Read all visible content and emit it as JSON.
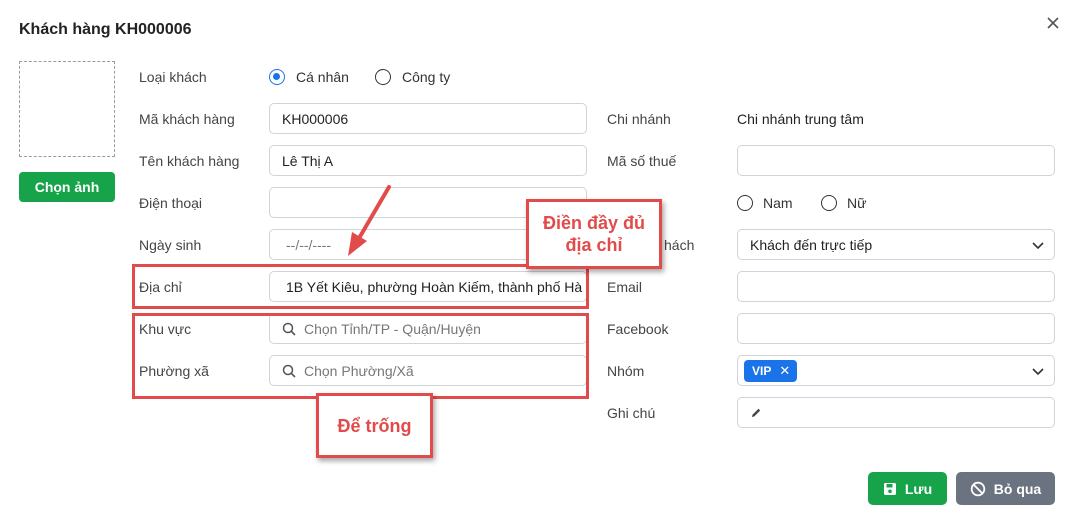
{
  "dialog": {
    "title": "Khách hàng KH000006"
  },
  "photo": {
    "button_label": "Chọn ảnh"
  },
  "left": {
    "customer_type_label": "Loại khách",
    "type_personal": "Cá nhân",
    "type_company": "Công ty",
    "customer_code_label": "Mã khách hàng",
    "customer_code_value": "KH000006",
    "customer_name_label": "Tên khách hàng",
    "customer_name_value": "Lê Thị A",
    "phone_label": "Điện thoại",
    "phone_value": "",
    "birthday_label": "Ngày sinh",
    "birthday_placeholder": "--/--/----",
    "address_label": "Địa chỉ",
    "address_value": "1B Yết Kiêu, phường Hoàn Kiếm, thành phố Hà",
    "area_label": "Khu vực",
    "area_placeholder": "Chọn Tỉnh/TP - Quận/Huyện",
    "ward_label": "Phường xã",
    "ward_placeholder": "Chọn Phường/Xã"
  },
  "right": {
    "branch_label": "Chi nhánh",
    "branch_value": "Chi nhánh trung tâm",
    "tax_label": "Mã số thuế",
    "gender_male": "Nam",
    "gender_female": "Nữ",
    "source_label_visible": "hách",
    "source_value": "Khách đến trực tiếp",
    "email_label": "Email",
    "facebook_label": "Facebook",
    "group_label": "Nhóm",
    "group_tag": "VIP",
    "note_label": "Ghi chú"
  },
  "annotations": {
    "callout_address_line1": "Điền đầy đủ",
    "callout_address_line2": "địa chỉ",
    "callout_empty": "Để trống",
    "color": "#e24b4b"
  },
  "footer": {
    "save_label": "Lưu",
    "skip_label": "Bỏ qua"
  },
  "colors": {
    "primary": "#1a73e8",
    "success": "#16a34a",
    "muted": "#6b7280"
  }
}
